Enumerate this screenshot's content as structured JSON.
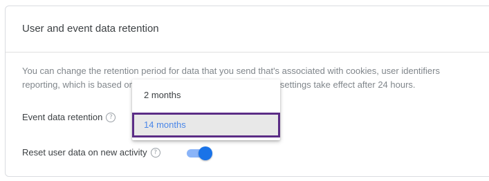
{
  "card": {
    "title": "User and event data retention",
    "description_line1": "You can change the retention period for data that you send that's associated with cookies, user identifiers",
    "description_line2": "reporting, which is based on aggregated data. Changes to these settings take effect after 24 hours."
  },
  "event_retention": {
    "label": "Event data retention",
    "options": [
      "2 months",
      "14 months"
    ],
    "selected": "14 months"
  },
  "reset_user_data": {
    "label": "Reset user data on new activity",
    "enabled": true
  },
  "icons": {
    "help": "?"
  },
  "colors": {
    "accent": "#1a73e8",
    "toggle_track": "#8ab4f8",
    "highlight_border": "#5b2d86",
    "selected_text": "#4a86e8"
  }
}
